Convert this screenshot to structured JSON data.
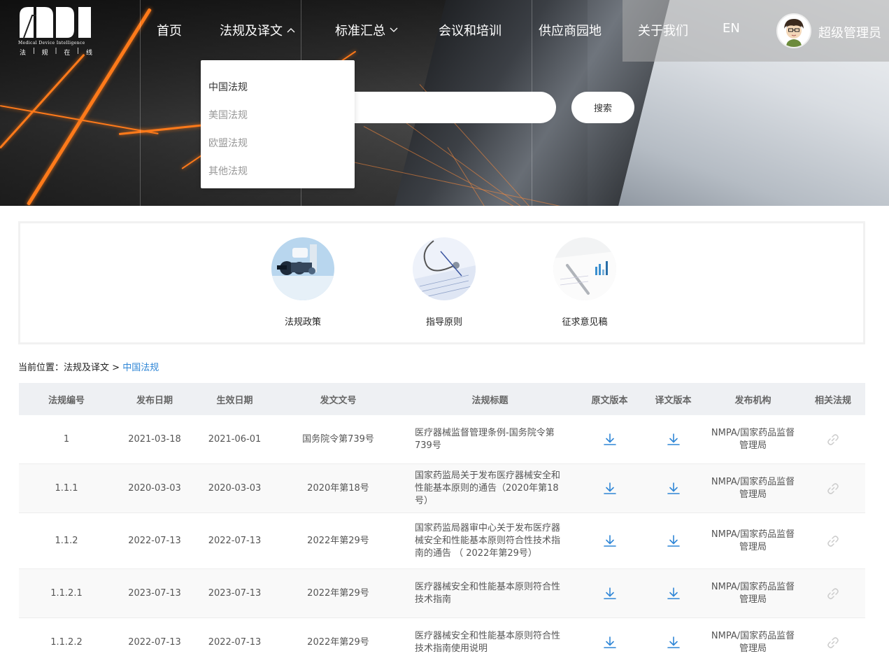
{
  "logo": {
    "subtitle": "Medical Device Intelligence",
    "cn_chars": [
      "法",
      "规",
      "在",
      "线"
    ]
  },
  "nav": {
    "items": [
      {
        "label": "首页",
        "has_chevron": false
      },
      {
        "label": "法规及译文",
        "has_chevron": true,
        "chevron": "up"
      },
      {
        "label": "标准汇总",
        "has_chevron": true,
        "chevron": "down"
      },
      {
        "label": "会议和培训",
        "has_chevron": false
      },
      {
        "label": "供应商园地",
        "has_chevron": false
      },
      {
        "label": "关于我们",
        "has_chevron": false
      },
      {
        "label": "EN",
        "has_chevron": false
      }
    ],
    "user_name": "超级管理员"
  },
  "dropdown": {
    "items": [
      {
        "label": "中国法规",
        "active": true
      },
      {
        "label": "美国法规",
        "active": false
      },
      {
        "label": "欧盟法规",
        "active": false
      },
      {
        "label": "其他法规",
        "active": false
      }
    ]
  },
  "search": {
    "value": "",
    "placeholder": "",
    "button_label": "搜索"
  },
  "categories": [
    {
      "label": "法规政策",
      "icon": "microscope-image"
    },
    {
      "label": "指导原则",
      "icon": "stethoscope-image"
    },
    {
      "label": "征求意见稿",
      "icon": "report-chart-image"
    }
  ],
  "breadcrumb": {
    "prefix": "当前位置：",
    "parent": "法规及译文",
    "separator": " > ",
    "current": "中国法规"
  },
  "table": {
    "headers": [
      "法规编号",
      "发布日期",
      "生效日期",
      "发文文号",
      "法规标题",
      "原文版本",
      "译文版本",
      "发布机构",
      "相关法规"
    ],
    "rows": [
      {
        "id": "1",
        "publish": "2021-03-18",
        "effective": "2021-06-01",
        "doc_no": "国务院令第739号",
        "title": "医疗器械监督管理条例-国务院令第739号",
        "agency": "NMPA/国家药品监督管理局"
      },
      {
        "id": "1.1.1",
        "publish": "2020-03-03",
        "effective": "2020-03-03",
        "doc_no": "2020年第18号",
        "title": "国家药监局关于发布医疗器械安全和性能基本原则的通告（2020年第18号）",
        "agency": "NMPA/国家药品监督管理局"
      },
      {
        "id": "1.1.2",
        "publish": "2022-07-13",
        "effective": "2022-07-13",
        "doc_no": "2022年第29号",
        "title": "国家药监局器审中心关于发布医疗器械安全和性能基本原则符合性技术指南的通告 （ 2022年第29号）",
        "agency": "NMPA/国家药品监督管理局"
      },
      {
        "id": "1.1.2.1",
        "publish": "2023-07-13",
        "effective": "2023-07-13",
        "doc_no": "2022年第29号",
        "title": "医疗器械安全和性能基本原则符合性技术指南",
        "agency": "NMPA/国家药品监督管理局"
      },
      {
        "id": "1.1.2.2",
        "publish": "2022-07-13",
        "effective": "2022-07-13",
        "doc_no": "2022年第29号",
        "title": "医疗器械安全和性能基本原则符合性技术指南使用说明",
        "agency": "NMPA/国家药品监督管理局"
      }
    ]
  },
  "colors": {
    "accent_blue": "#2f86d6",
    "header_bg": "#eef0f3",
    "link_icon": "#cccccc"
  }
}
